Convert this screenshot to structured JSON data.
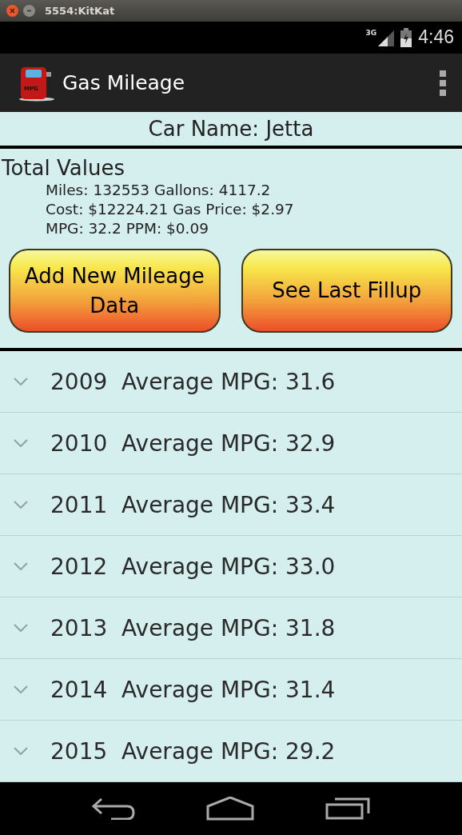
{
  "window": {
    "title": "5554:KitKat"
  },
  "status_bar": {
    "network": "3G",
    "time": "4:46"
  },
  "action_bar": {
    "icon_label": "MPG",
    "title": "Gas Mileage"
  },
  "car_name": "Car Name: Jetta",
  "totals": {
    "heading": "Total Values",
    "lines": [
      "Miles: 132553 Gallons: 4117.2",
      "Cost: $12224.21 Gas Price: $2.97",
      "MPG: 32.2 PPM: $0.09"
    ]
  },
  "buttons": [
    "Add New Mileage Data",
    "See Last Fillup"
  ],
  "years": [
    {
      "year": "2009",
      "label": "Average MPG: 31.6",
      "expanded": false
    },
    {
      "year": "2010",
      "label": "Average MPG: 32.9",
      "expanded": false
    },
    {
      "year": "2011",
      "label": "Average MPG: 33.4",
      "expanded": false
    },
    {
      "year": "2012",
      "label": "Average MPG: 33.0",
      "expanded": false
    },
    {
      "year": "2013",
      "label": "Average MPG: 31.8",
      "expanded": false
    },
    {
      "year": "2014",
      "label": "Average MPG: 31.4",
      "expanded": false
    },
    {
      "year": "2015",
      "label": "Average MPG: 29.2",
      "expanded": false
    }
  ]
}
